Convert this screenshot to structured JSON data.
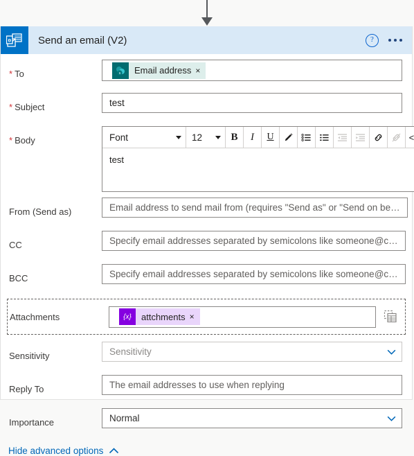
{
  "connector": {
    "icon": "down-arrow-icon",
    "color": "#56595c"
  },
  "header": {
    "title": "Send an email (V2)",
    "app_icon": "outlook-icon",
    "app_icon_bg": "#0072c6",
    "bar_bg": "#d9e9f7",
    "help_label": "?",
    "help_icon": "help-circle-icon",
    "overflow_icon": "ellipsis-icon"
  },
  "fields": {
    "to": {
      "label": "To",
      "required": true,
      "token": {
        "text": "Email address",
        "icon": "sharepoint-icon",
        "remove": "×",
        "bg": "#ddeeeb",
        "icon_bg": "#036c70"
      }
    },
    "subject": {
      "label": "Subject",
      "required": true,
      "value": "test"
    },
    "body": {
      "label": "Body",
      "required": true,
      "value": "test",
      "toolbar": {
        "font_name": "Font",
        "font_size": "12",
        "bold": "B",
        "italic": "I",
        "underline": "U",
        "highlight_icon": "pen-icon",
        "numbered_list_icon": "numbered-list-icon",
        "bullet_list_icon": "bullet-list-icon",
        "outdent_icon": "outdent-icon",
        "indent_icon": "indent-icon",
        "link_icon": "link-icon",
        "unlink_icon": "unlink-icon",
        "code_label": "</>"
      }
    },
    "from": {
      "label": "From (Send as)",
      "placeholder": "Email address to send mail from (requires \"Send as\" or \"Send on be…"
    },
    "cc": {
      "label": "CC",
      "placeholder": "Specify email addresses separated by semicolons like someone@c…"
    },
    "bcc": {
      "label": "BCC",
      "placeholder": "Specify email addresses separated by semicolons like someone@c…"
    },
    "attachments": {
      "label": "Attachments",
      "token": {
        "text": "attchments",
        "icon": "expression-variable-icon",
        "icon_label": "{x}",
        "remove": "×",
        "bg": "#e9d5fb",
        "icon_bg": "#8500e0"
      },
      "array_toggle_icon": "switch-to-array-icon"
    },
    "sensitivity": {
      "label": "Sensitivity",
      "placeholder": "Sensitivity",
      "chevron_icon": "chevron-down-icon"
    },
    "reply_to": {
      "label": "Reply To",
      "placeholder": "The email addresses to use when replying"
    },
    "importance": {
      "label": "Importance",
      "value": "Normal",
      "chevron_icon": "chevron-down-icon"
    }
  },
  "footer": {
    "advanced_link": "Hide advanced options",
    "chevron_icon": "chevron-up-icon",
    "link_color": "#0067b8"
  }
}
